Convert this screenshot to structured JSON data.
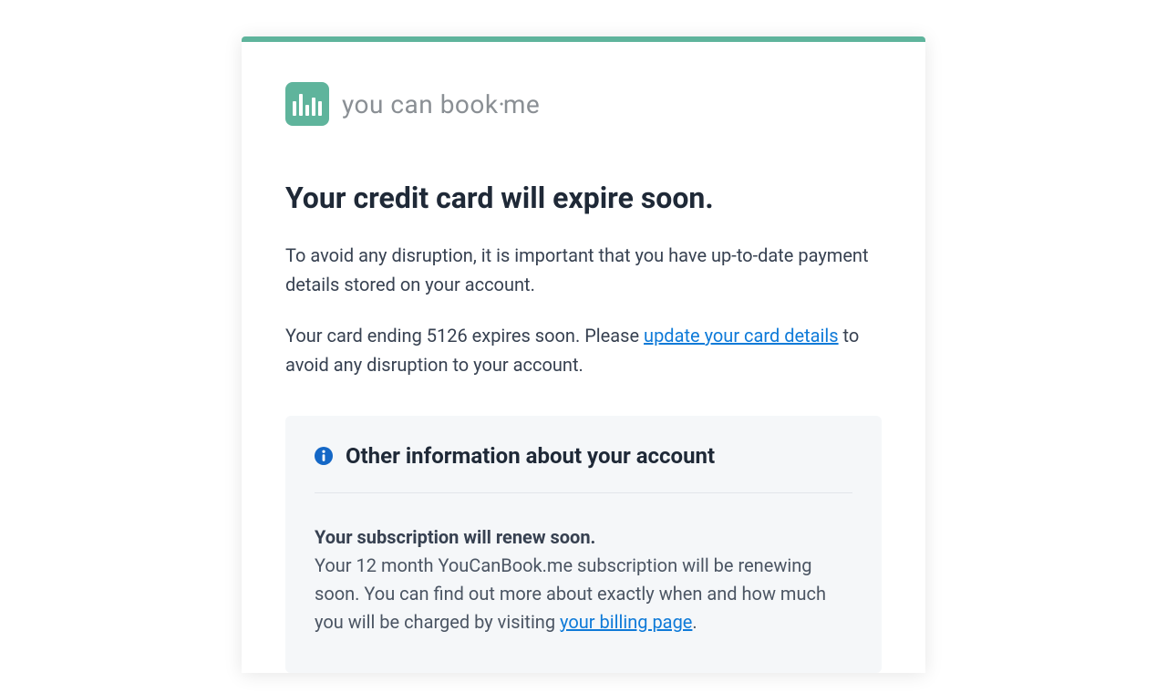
{
  "brand": {
    "name": "you can book·me"
  },
  "headline": "Your credit card will expire soon.",
  "paragraph1": "To avoid any disruption, it is important that you have up-to-date payment details stored on your account.",
  "paragraph2_pre": "Your card ending 5126 expires soon. Please ",
  "paragraph2_link": "update your card details",
  "paragraph2_post": " to avoid any disruption to your account.",
  "info": {
    "title": "Other information about your account",
    "sub_heading": "Your subscription will renew soon.",
    "sub_body_pre": "Your 12 month YouCanBook.me subscription will be renewing soon. You can find out more about exactly when and how much you will be charged by visiting ",
    "sub_body_link": "your billing page",
    "sub_body_post": "."
  }
}
